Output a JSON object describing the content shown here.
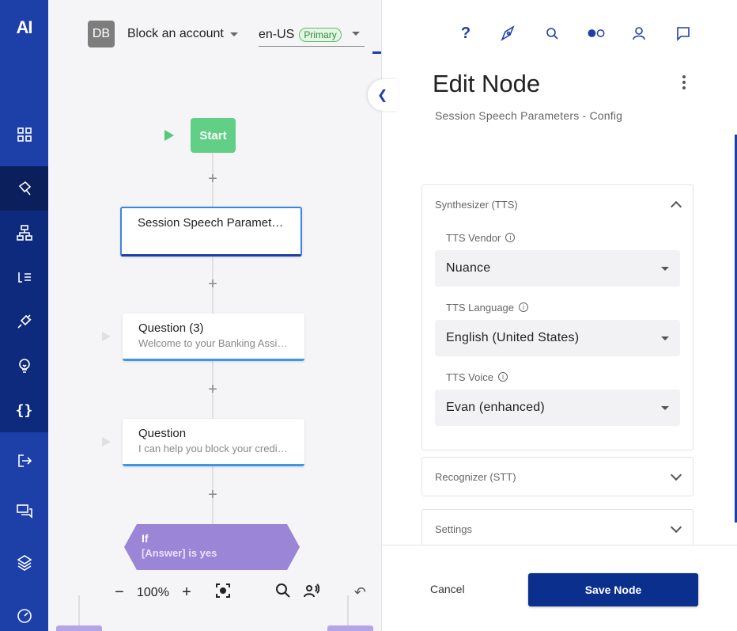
{
  "nav": {
    "logo": "AI",
    "items": [
      {
        "name": "dashboard-icon"
      },
      {
        "name": "build-icon"
      },
      {
        "name": "flow-icon"
      },
      {
        "name": "lexicon-icon"
      },
      {
        "name": "plug-icon"
      },
      {
        "name": "lightbulb-icon"
      },
      {
        "name": "braces-icon",
        "glyph": "{}"
      },
      {
        "name": "exit-icon"
      },
      {
        "name": "conversations-icon"
      },
      {
        "name": "layers-icon"
      },
      {
        "name": "gauge-icon"
      }
    ]
  },
  "topbar": {
    "avatar": "DB",
    "flow_name": "Block an account",
    "locale": "en-US",
    "locale_badge": "Primary"
  },
  "canvas": {
    "start_label": "Start",
    "nodes": [
      {
        "title": "Session Speech Parameters - Config",
        "subtitle": ""
      },
      {
        "title": "Question (3)",
        "subtitle": "Welcome to your Banking Assistant"
      },
      {
        "title": "Question",
        "subtitle": "I can help you block your credit card"
      }
    ],
    "if_node": {
      "title": "If",
      "condition": "[Answer] is yes"
    },
    "zoom": {
      "minus": "−",
      "value": "100%",
      "plus": "+"
    }
  },
  "panel": {
    "title": "Edit Node",
    "subtitle": "Session Speech Parameters - Config",
    "sections": {
      "tts": {
        "header": "Synthesizer (TTS)",
        "vendor_label": "TTS Vendor",
        "vendor_value": "Nuance",
        "language_label": "TTS Language",
        "language_value": "English (United States)",
        "voice_label": "TTS Voice",
        "voice_value": "Evan (enhanced)"
      },
      "stt": {
        "header": "Recognizer (STT)"
      },
      "settings": {
        "header": "Settings"
      }
    },
    "cancel_label": "Cancel",
    "save_label": "Save Node"
  },
  "colors": {
    "nav": "#1d3fa8",
    "primary_button": "#0b2f8c",
    "start_node": "#62cf86",
    "if_node": "#9a85d6",
    "question_border": "#3c96ea"
  }
}
